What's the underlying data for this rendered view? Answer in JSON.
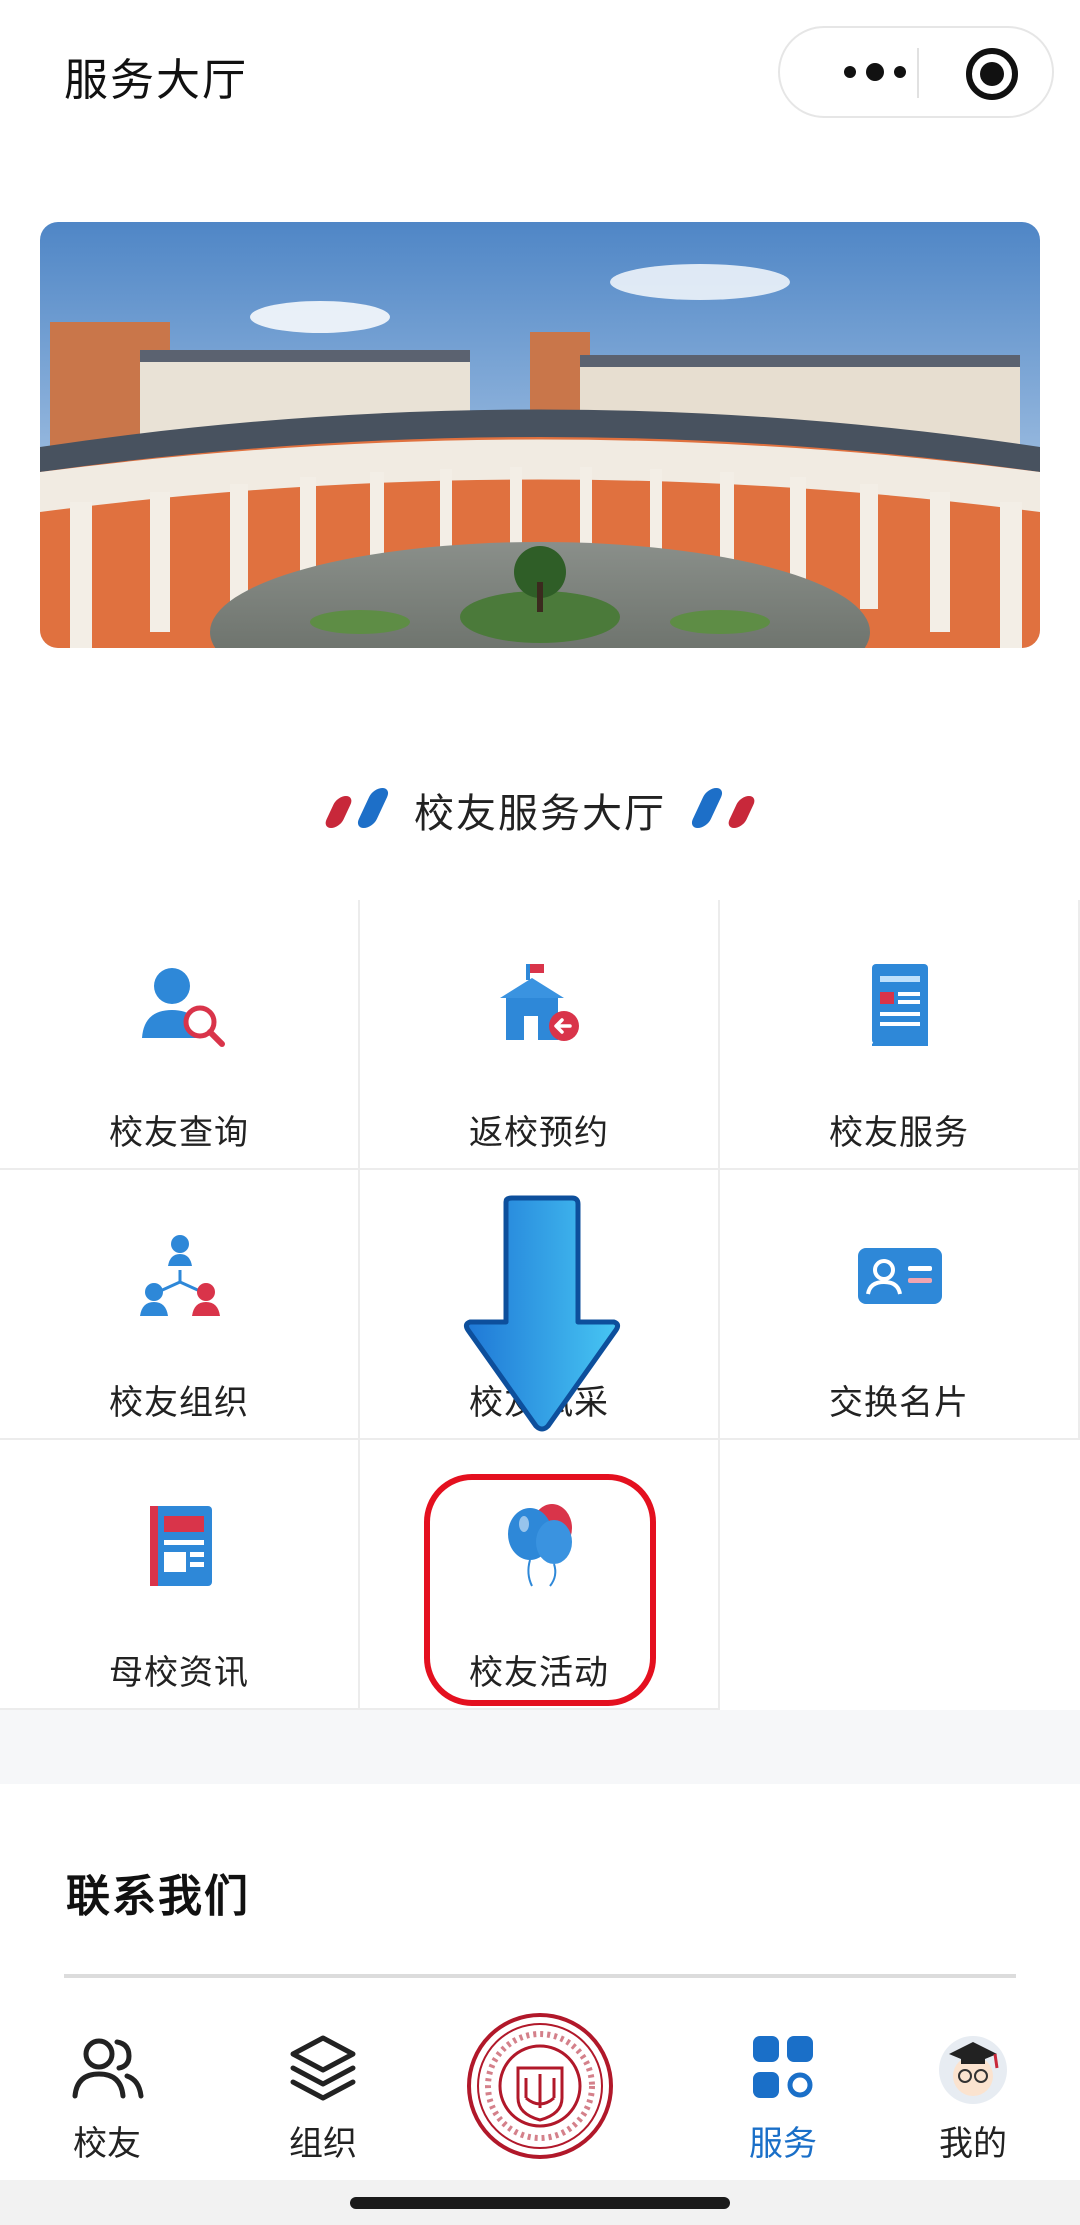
{
  "header": {
    "title": "服务大厅"
  },
  "banner": {
    "image_subject": "campus-building-photo"
  },
  "section": {
    "title": "校友服务大厅"
  },
  "grid": {
    "items": [
      {
        "label": "校友查询",
        "icon": "alumni-search-icon"
      },
      {
        "label": "返校预约",
        "icon": "return-school-icon"
      },
      {
        "label": "校友服务",
        "icon": "service-document-icon"
      },
      {
        "label": "校友组织",
        "icon": "organization-icon"
      },
      {
        "label": "校友风采",
        "icon": "style-icon"
      },
      {
        "label": "交换名片",
        "icon": "business-card-icon"
      },
      {
        "label": "母校资讯",
        "icon": "news-icon"
      },
      {
        "label": "校友活动",
        "icon": "balloons-icon"
      }
    ]
  },
  "contact": {
    "title": "联系我们"
  },
  "tabbar": {
    "items": [
      {
        "label": "校友",
        "icon": "people-icon",
        "active": false
      },
      {
        "label": "组织",
        "icon": "layers-icon",
        "active": false
      },
      {
        "label": "",
        "icon": "university-logo",
        "active": false
      },
      {
        "label": "服务",
        "icon": "grid-icon",
        "active": true
      },
      {
        "label": "我的",
        "icon": "avatar-icon",
        "active": false
      }
    ]
  },
  "colors": {
    "accent_blue": "#1a6fc8",
    "accent_red": "#c8283a",
    "highlight_red": "#e4101f"
  }
}
